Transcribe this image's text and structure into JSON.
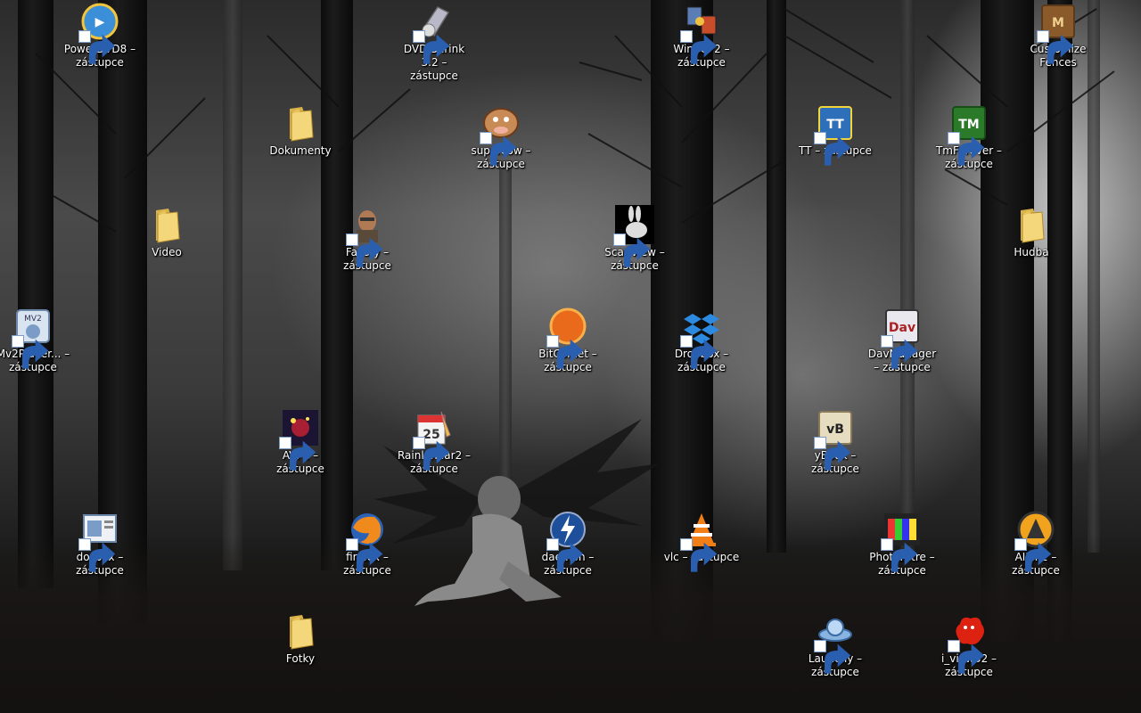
{
  "desktop": {
    "icons": [
      {
        "label": "PowerDVD8 – zástupce",
        "icon": "powerdvd-icon",
        "shortcut": true
      },
      {
        "label": "DVD Shrink 3.2 – zástupce",
        "icon": "dvdshrink-icon",
        "shortcut": true
      },
      {
        "label": "WinSCP2 – zástupce",
        "icon": "winscp-icon",
        "shortcut": true
      },
      {
        "label": "Customize Fences",
        "icon": "fences-icon",
        "shortcut": true
      },
      {
        "label": "Dokumenty",
        "icon": "folder-icon",
        "shortcut": false
      },
      {
        "label": "supercow – zástupce",
        "icon": "supercow-icon",
        "shortcut": true
      },
      {
        "label": "TT – zástupce",
        "icon": "tt-icon",
        "shortcut": true
      },
      {
        "label": "TmForever – zástupce",
        "icon": "tmforever-icon",
        "shortcut": true
      },
      {
        "label": "Video",
        "icon": "folder-icon",
        "shortcut": false
      },
      {
        "label": "FarCry – zástupce",
        "icon": "farcry-icon",
        "shortcut": true
      },
      {
        "label": "ScanView – zástupce",
        "icon": "scanview-icon",
        "shortcut": true
      },
      {
        "label": "Hudba",
        "icon": "folder-icon",
        "shortcut": false
      },
      {
        "label": "Mv2Player... – zástupce",
        "icon": "mv2player-icon",
        "shortcut": true
      },
      {
        "label": "BitComet – zástupce",
        "icon": "bitcomet-icon",
        "shortcut": true
      },
      {
        "label": "Dropbox – zástupce",
        "icon": "dropbox-icon",
        "shortcut": true
      },
      {
        "label": "DavManager – zástupce",
        "icon": "davmanager-icon",
        "shortcut": true
      },
      {
        "label": "AVP2 – zástupce",
        "icon": "avp2-icon",
        "shortcut": true
      },
      {
        "label": "Rainlendar2 – zástupce",
        "icon": "rainlendar-icon",
        "shortcut": true
      },
      {
        "label": "yBook – zástupce",
        "icon": "ybook-icon",
        "shortcut": true
      },
      {
        "label": "dosbox – zástupce",
        "icon": "dosbox-icon",
        "shortcut": true
      },
      {
        "label": "firefox – zástupce",
        "icon": "firefox-icon",
        "shortcut": true
      },
      {
        "label": "daemon – zástupce",
        "icon": "daemon-icon",
        "shortcut": true
      },
      {
        "label": "vlc – zástupce",
        "icon": "vlc-icon",
        "shortcut": true
      },
      {
        "label": "PhotoFiltre – zástupce",
        "icon": "photofiltre-icon",
        "shortcut": true
      },
      {
        "label": "AIMP2 – zástupce",
        "icon": "aimp-icon",
        "shortcut": true
      },
      {
        "label": "Fotky",
        "icon": "folder-icon",
        "shortcut": false
      },
      {
        "label": "Launchy – zástupce",
        "icon": "launchy-icon",
        "shortcut": true
      },
      {
        "label": "i_view32 – zástupce",
        "icon": "irfanview-icon",
        "shortcut": true
      }
    ]
  }
}
